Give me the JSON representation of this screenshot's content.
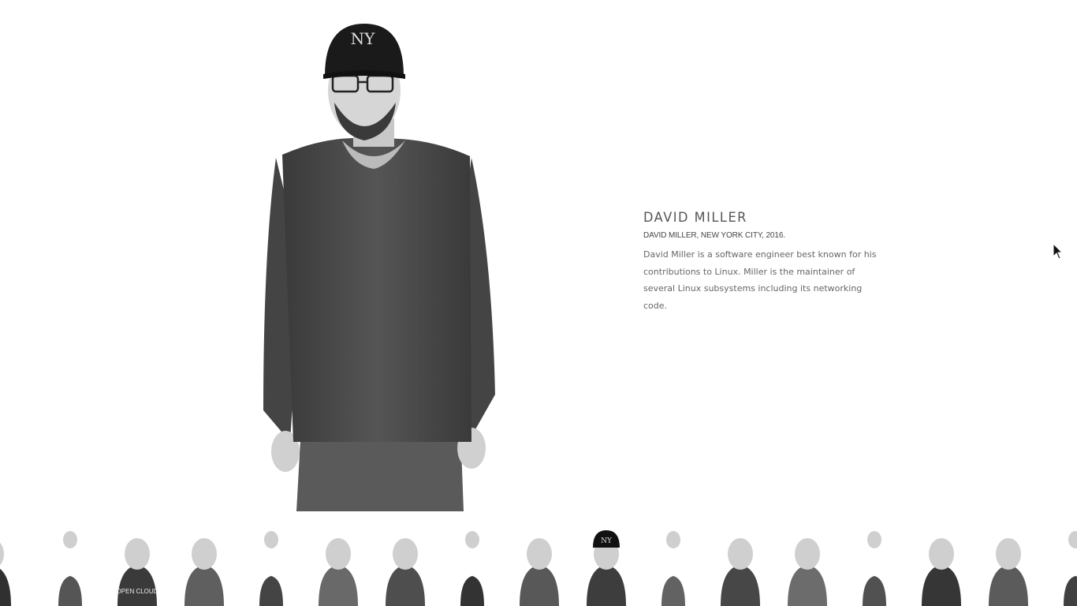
{
  "featured": {
    "name": "DAVID MILLER",
    "caption": "DAVID MILLER, NEW YORK CITY, 2016.",
    "description": "David Miller is a software engineer best known for his contributions to Linux. Miller is the maintainer of several Linux subsystems including its networking code.",
    "cap_logo": "NY"
  },
  "thumbnails": [
    {
      "label": "portrait-1"
    },
    {
      "label": "portrait-2"
    },
    {
      "label": "portrait-3",
      "shirt_text": "OPEN CLOUD"
    },
    {
      "label": "portrait-4"
    },
    {
      "label": "portrait-5"
    },
    {
      "label": "portrait-6"
    },
    {
      "label": "portrait-7"
    },
    {
      "label": "portrait-8"
    },
    {
      "label": "portrait-9"
    },
    {
      "label": "portrait-10",
      "cap_logo": "NY"
    },
    {
      "label": "portrait-11"
    },
    {
      "label": "portrait-12"
    },
    {
      "label": "portrait-13"
    },
    {
      "label": "portrait-14"
    },
    {
      "label": "portrait-15"
    },
    {
      "label": "portrait-16"
    },
    {
      "label": "portrait-17"
    }
  ]
}
